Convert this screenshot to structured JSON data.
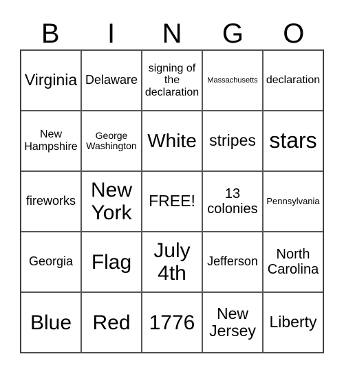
{
  "header": {
    "letters": [
      "B",
      "I",
      "N",
      "G",
      "O"
    ]
  },
  "card": {
    "rows": [
      [
        "Virginia",
        "Delaware",
        "signing of the declaration",
        "Massachusetts",
        "declaration"
      ],
      [
        "New Hampshire",
        "George Washington",
        "White",
        "stripes",
        "stars"
      ],
      [
        "fireworks",
        "New York",
        "FREE!",
        "13 colonies",
        "Pennsylvania"
      ],
      [
        "Georgia",
        "Flag",
        "July 4th",
        "Jefferson",
        "North Carolina"
      ],
      [
        "Blue",
        "Red",
        "1776",
        "New Jersey",
        "Liberty"
      ]
    ]
  }
}
